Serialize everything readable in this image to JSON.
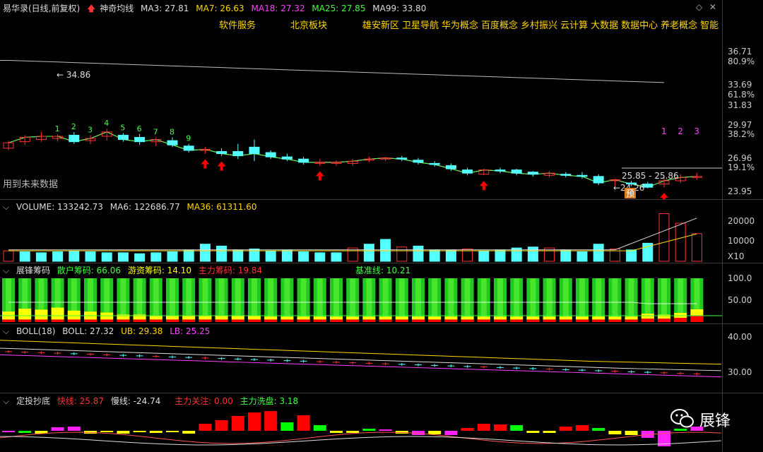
{
  "main": {
    "title": "易华录(日线,前复权)",
    "indicator": "神奇均线",
    "ma": [
      {
        "label": "MA3: 27.81",
        "color": "#dddddd"
      },
      {
        "label": "MA7: 26.63",
        "color": "#ffd700"
      },
      {
        "label": "MA18: 27.32",
        "color": "#ff40ff"
      },
      {
        "label": "MA25: 27.85",
        "color": "#40ff40"
      },
      {
        "label": "MA99: 33.80",
        "color": "#dddddd"
      }
    ],
    "concepts_row1": [
      "软件服务",
      "北京板块"
    ],
    "concepts_row2": [
      "雄安新区",
      "卫星导航",
      "华为概念",
      "百度概念",
      "乡村振兴",
      "云计算",
      "大数据",
      "数据中心",
      "养老概念",
      "智能"
    ],
    "future_note": "用到未来数据",
    "high_label": "34.86",
    "low_label": "24.26",
    "range_label": "25.85 - 25.86",
    "box_label": "预",
    "count_labels_green": [
      "1",
      "2",
      "3",
      "4",
      "5",
      "6",
      "7",
      "8",
      "9"
    ],
    "count_labels_magenta": [
      "1",
      "2",
      "3"
    ],
    "axis": [
      "36.71",
      "80.9%",
      "33.69",
      "61.8%",
      "31.83",
      "29.97",
      "38.2%",
      "26.96",
      "19.1%",
      "23.95"
    ],
    "candles": [
      [
        27.8,
        28.3,
        28.5,
        27.6
      ],
      [
        28.4,
        28.8,
        29.0,
        28.1
      ],
      [
        28.6,
        28.9,
        29.3,
        28.4
      ],
      [
        28.7,
        28.9,
        29.1,
        28.4
      ],
      [
        29.0,
        28.4,
        29.3,
        28.2
      ],
      [
        28.5,
        28.7,
        29.0,
        28.2
      ],
      [
        28.9,
        29.3,
        29.6,
        28.5
      ],
      [
        29.0,
        28.6,
        29.2,
        28.4
      ],
      [
        28.8,
        28.4,
        29.1,
        28.1
      ],
      [
        28.4,
        28.6,
        28.8,
        28.0
      ],
      [
        28.5,
        28.1,
        28.8,
        27.9
      ],
      [
        28.0,
        27.6,
        28.2,
        27.4
      ],
      [
        27.6,
        27.7,
        27.9,
        27.3
      ],
      [
        27.5,
        27.3,
        27.8,
        27.1
      ],
      [
        27.5,
        27.1,
        28.2,
        26.8
      ],
      [
        27.9,
        27.3,
        28.6,
        26.6
      ],
      [
        27.4,
        27.0,
        27.6,
        26.8
      ],
      [
        27.0,
        26.8,
        27.3,
        26.6
      ],
      [
        26.8,
        26.5,
        27.0,
        26.3
      ],
      [
        26.4,
        26.5,
        26.8,
        26.2
      ],
      [
        26.4,
        26.5,
        26.7,
        26.2
      ],
      [
        26.4,
        26.6,
        26.8,
        26.2
      ],
      [
        26.7,
        26.8,
        27.0,
        26.5
      ],
      [
        26.8,
        26.9,
        27.0,
        26.6
      ],
      [
        26.9,
        26.8,
        27.1,
        26.6
      ],
      [
        26.7,
        26.5,
        26.9,
        26.3
      ],
      [
        26.4,
        26.3,
        26.6,
        26.1
      ],
      [
        26.2,
        25.9,
        26.4,
        25.7
      ],
      [
        25.8,
        25.5,
        26.0,
        25.3
      ],
      [
        25.4,
        25.8,
        25.9,
        25.3
      ],
      [
        25.8,
        25.7,
        26.0,
        25.5
      ],
      [
        25.8,
        25.5,
        25.9,
        25.3
      ],
      [
        25.6,
        25.4,
        25.7,
        25.2
      ],
      [
        25.3,
        25.5,
        25.7,
        25.1
      ],
      [
        25.4,
        25.3,
        25.6,
        25.1
      ],
      [
        25.3,
        25.2,
        25.6,
        25.0
      ],
      [
        25.2,
        24.6,
        25.4,
        24.4
      ],
      [
        24.8,
        24.9,
        25.0,
        24.3
      ],
      [
        24.6,
        24.5,
        24.8,
        24.3
      ],
      [
        24.5,
        24.2,
        24.7,
        24.1
      ],
      [
        24.5,
        24.8,
        25.3,
        24.2
      ],
      [
        24.8,
        25.1,
        25.4,
        24.6
      ],
      [
        25.1,
        25.2,
        25.5,
        24.9
      ]
    ]
  },
  "volume": {
    "title": "VOLUME: 133242.73",
    "ma6": "MA6: 122686.77",
    "ma36": "MA36: 61311.60",
    "axis": [
      "20000",
      "10000",
      "X10"
    ],
    "bars": [
      [
        1.1,
        "u"
      ],
      [
        1.0,
        "d"
      ],
      [
        0.9,
        "d"
      ],
      [
        1.0,
        "d"
      ],
      [
        1.1,
        "d"
      ],
      [
        1.0,
        "d"
      ],
      [
        0.9,
        "d"
      ],
      [
        0.9,
        "d"
      ],
      [
        0.8,
        "d"
      ],
      [
        0.9,
        "d"
      ],
      [
        1.0,
        "d"
      ],
      [
        1.2,
        "d"
      ],
      [
        1.8,
        "d"
      ],
      [
        1.6,
        "d"
      ],
      [
        1.2,
        "d"
      ],
      [
        1.3,
        "d"
      ],
      [
        1.1,
        "d"
      ],
      [
        1.2,
        "d"
      ],
      [
        1.0,
        "d"
      ],
      [
        0.9,
        "d"
      ],
      [
        0.9,
        "d"
      ],
      [
        1.4,
        "u"
      ],
      [
        1.8,
        "d"
      ],
      [
        2.3,
        "d"
      ],
      [
        1.5,
        "u"
      ],
      [
        1.6,
        "d"
      ],
      [
        1.2,
        "d"
      ],
      [
        1.2,
        "d"
      ],
      [
        1.3,
        "u"
      ],
      [
        1.1,
        "d"
      ],
      [
        1.2,
        "d"
      ],
      [
        1.4,
        "d"
      ],
      [
        1.5,
        "d"
      ],
      [
        1.4,
        "u"
      ],
      [
        1.2,
        "d"
      ],
      [
        1.0,
        "d"
      ],
      [
        1.8,
        "d"
      ],
      [
        1.3,
        "u"
      ],
      [
        1.2,
        "d"
      ],
      [
        1.9,
        "d"
      ],
      [
        5.0,
        "u"
      ],
      [
        4.0,
        "u"
      ],
      [
        2.9,
        "u"
      ]
    ]
  },
  "chips": {
    "title": "展锋筹码",
    "retail": "散户筹码: 66.06",
    "hot": "游资筹码: 14.10",
    "main": "主力筹码: 19.84",
    "base": "基准线: 10.21",
    "axis": [
      "100.0",
      "50.00"
    ]
  },
  "boll": {
    "title": "BOLL(18)",
    "boll": "BOLL: 27.32",
    "ub": "UB: 29.38",
    "lb": "LB: 25.25",
    "axis": [
      "40.00",
      "30.00"
    ]
  },
  "dingtou": {
    "title": "定投抄底",
    "fast": "快线: 25.87",
    "slow": "慢线: -24.74",
    "attention": "主力关注: 0.00",
    "wash": "主力洗盘: 3.18",
    "watermark": "展锋"
  },
  "colors": {
    "up": "#ff3333",
    "down": "#54ffff",
    "green": "#00ff00",
    "yellow": "#ffff00",
    "magenta": "#ff40ff",
    "red": "#ff0000"
  }
}
